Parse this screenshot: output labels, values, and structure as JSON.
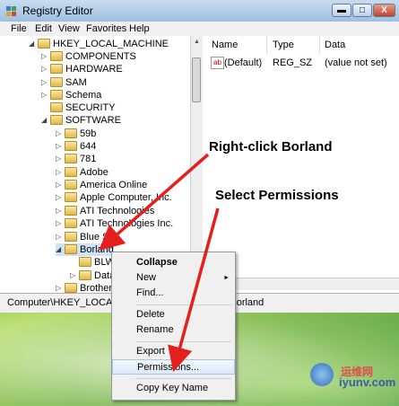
{
  "window": {
    "title": "Registry Editor",
    "controls": {
      "minimize": "▬",
      "maximize": "□",
      "close": "X"
    }
  },
  "menubar": [
    "File",
    "Edit",
    "View",
    "Favorites",
    "Help"
  ],
  "tree": [
    {
      "label": "HKEY_LOCAL_MACHINE",
      "expander": "◢",
      "selected": false
    },
    {
      "label": "COMPONENTS",
      "expander": "▷",
      "selected": false
    },
    {
      "label": "HARDWARE",
      "expander": "▷",
      "selected": false
    },
    {
      "label": "SAM",
      "expander": "▷",
      "selected": false
    },
    {
      "label": "Schema",
      "expander": "▷",
      "selected": false
    },
    {
      "label": "SECURITY",
      "expander": "",
      "selected": false
    },
    {
      "label": "SOFTWARE",
      "expander": "◢",
      "selected": false
    },
    {
      "label": "59b",
      "expander": "▷",
      "selected": false
    },
    {
      "label": "644",
      "expander": "▷",
      "selected": false
    },
    {
      "label": "781",
      "expander": "▷",
      "selected": false
    },
    {
      "label": "Adobe",
      "expander": "▷",
      "selected": false
    },
    {
      "label": "America Online",
      "expander": "▷",
      "selected": false
    },
    {
      "label": "Apple Computer, Inc.",
      "expander": "▷",
      "selected": false
    },
    {
      "label": "ATI Technologies",
      "expander": "▷",
      "selected": false
    },
    {
      "label": "ATI Technologies Inc.",
      "expander": "▷",
      "selected": false
    },
    {
      "label": "Blue Sp...",
      "expander": "▷",
      "selected": false
    },
    {
      "label": "Borland",
      "expander": "◢",
      "selected": true
    },
    {
      "label": "BLW",
      "expander": "",
      "selected": false
    },
    {
      "label": "Data",
      "expander": "▷",
      "selected": false
    },
    {
      "label": "Brother",
      "expander": "▷",
      "selected": false
    }
  ],
  "values_pane": {
    "headers": [
      "Name",
      "Type",
      "Data"
    ],
    "rows": [
      {
        "name": "(Default)",
        "type": "REG_SZ",
        "data": "(value not set)",
        "icon": "ab"
      }
    ]
  },
  "statusbar": {
    "path": "Computer\\HKEY_LOCAL_MACHINE\\SOFTWARE\\Borland"
  },
  "context_menu": {
    "items": [
      {
        "label": "Collapse",
        "bold": true
      },
      {
        "label": "New",
        "submenu": true
      },
      {
        "label": "Find..."
      },
      {
        "separator": true
      },
      {
        "label": "Delete"
      },
      {
        "label": "Rename"
      },
      {
        "separator": true
      },
      {
        "label": "Export"
      },
      {
        "label": "Permissions...",
        "highlighted": true
      },
      {
        "separator": true
      },
      {
        "label": "Copy Key Name"
      }
    ]
  },
  "annotations": {
    "right_click": "Right-click Borland",
    "select_permissions": "Select Permissions",
    "arrow_color": "#e3201b"
  },
  "watermark": {
    "text": "iyunv.com",
    "chinese": "运维网"
  }
}
